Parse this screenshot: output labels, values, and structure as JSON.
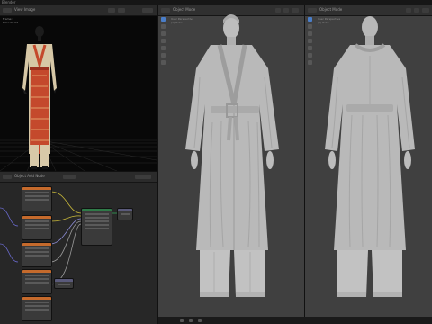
{
  "app_title": "Blender",
  "render_viewport": {
    "header": "View  Image",
    "overlay": [
      "Frame:1",
      "Time:00:03"
    ]
  },
  "node_editor": {
    "header": "Object  Add  Node",
    "nodes": [
      {
        "title": "Image Texture"
      },
      {
        "title": "Image Texture"
      },
      {
        "title": "Image Texture"
      },
      {
        "title": "Image Texture"
      },
      {
        "title": "Image Texture"
      },
      {
        "title": "Principled BSDF"
      },
      {
        "title": "Material Output"
      }
    ]
  },
  "viewport_front": {
    "header": "Object Mode",
    "overlay": [
      "User Perspective",
      "(1) Robe"
    ]
  },
  "viewport_back": {
    "header": "Object Mode",
    "overlay": [
      "User Perspective",
      "(1) Robe"
    ]
  },
  "colors": {
    "accent": "#4a7ec9",
    "node_texture": "#c56a2c",
    "node_shader": "#2f7a48",
    "robe_red": "#c04a2c",
    "robe_cream": "#d8c9a8",
    "clay": "#b5b5b5"
  }
}
